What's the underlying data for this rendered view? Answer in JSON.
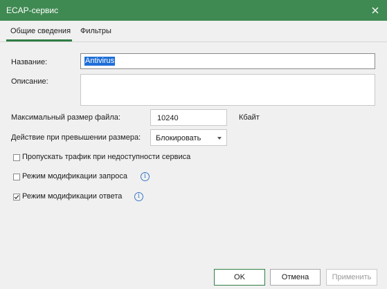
{
  "window": {
    "title": "ECAP-сервис"
  },
  "tabs": [
    {
      "label": "Общие сведения",
      "active": true
    },
    {
      "label": "Фильтры",
      "active": false
    }
  ],
  "form": {
    "name_label": "Название:",
    "name_value": "Antivirus",
    "description_label": "Описание:",
    "description_value": "",
    "max_size_label": "Максимальный размер файла:",
    "max_size_value": "10240",
    "max_size_unit": "Кбайт",
    "action_label": "Действие при превышении размера:",
    "action_value": "Блокировать",
    "checkboxes": [
      {
        "label": "Пропускать трафик при недоступности сервиса",
        "checked": false,
        "info": false
      },
      {
        "label": "Режим модификации запроса",
        "checked": false,
        "info": true
      },
      {
        "label": "Режим модификации ответа",
        "checked": true,
        "info": true
      }
    ]
  },
  "buttons": {
    "ok": "OK",
    "cancel": "Отмена",
    "apply": "Применить"
  },
  "colors": {
    "titlebar": "#3f8a52",
    "accent": "#2f7d44",
    "selection": "#1e6fd8",
    "info": "#3a78c6"
  },
  "icons": {
    "close": "close-icon",
    "info": "info-icon",
    "dropdown": "chevron-down-icon"
  }
}
